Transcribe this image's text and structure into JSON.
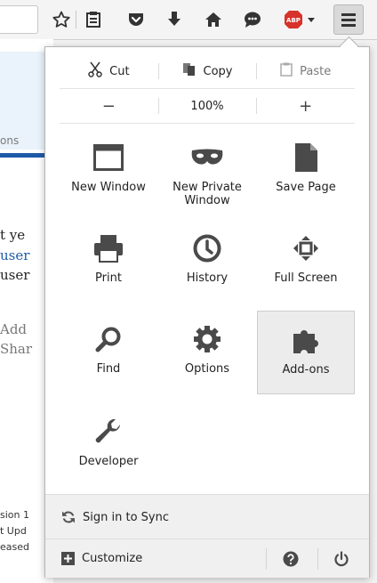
{
  "toolbar": {
    "icons": [
      "star-icon",
      "reading-list-icon",
      "pocket-icon",
      "download-icon",
      "home-icon",
      "chat-icon",
      "adblock-plus-icon",
      "hamburger-menu-icon"
    ],
    "adblock_label": "ABP",
    "colors": {
      "adblock_red": "#d7322b",
      "menu_button_bg": "#d9d9d9"
    }
  },
  "background_page": {
    "tab_fragment": "ons",
    "lines": [
      {
        "text": "t ye",
        "color": "#222222"
      },
      {
        "text": "user",
        "color": "#1e5aa8"
      },
      {
        "text": "user",
        "color": "#222222"
      },
      {
        "text": "Add",
        "color": "#777777"
      },
      {
        "text": "Shar",
        "color": "#777777"
      }
    ],
    "small_lines": [
      "sion 1",
      "t Upd",
      "eased"
    ],
    "colors": {
      "blue_bar": "#1e5aa8"
    }
  },
  "menu": {
    "edit": {
      "cut_label": "Cut",
      "copy_label": "Copy",
      "paste_label": "Paste"
    },
    "zoom": {
      "minus_label": "−",
      "level": "100%",
      "plus_label": "+"
    },
    "items": [
      {
        "label": "New Window",
        "icon": "window-icon"
      },
      {
        "label": "New Private\nWindow",
        "icon": "mask-icon"
      },
      {
        "label": "Save Page",
        "icon": "document-icon"
      },
      {
        "label": "Print",
        "icon": "printer-icon"
      },
      {
        "label": "History",
        "icon": "clock-icon"
      },
      {
        "label": "Full Screen",
        "icon": "fullscreen-icon"
      },
      {
        "label": "Find",
        "icon": "magnifier-icon"
      },
      {
        "label": "Options",
        "icon": "gear-icon"
      },
      {
        "label": "Add-ons",
        "icon": "puzzle-icon",
        "selected": true
      },
      {
        "label": "Developer",
        "icon": "wrench-icon"
      }
    ],
    "sync_label": "Sign in to Sync",
    "customize_label": "Customize",
    "footer_icons": [
      "help-icon",
      "power-icon"
    ]
  }
}
